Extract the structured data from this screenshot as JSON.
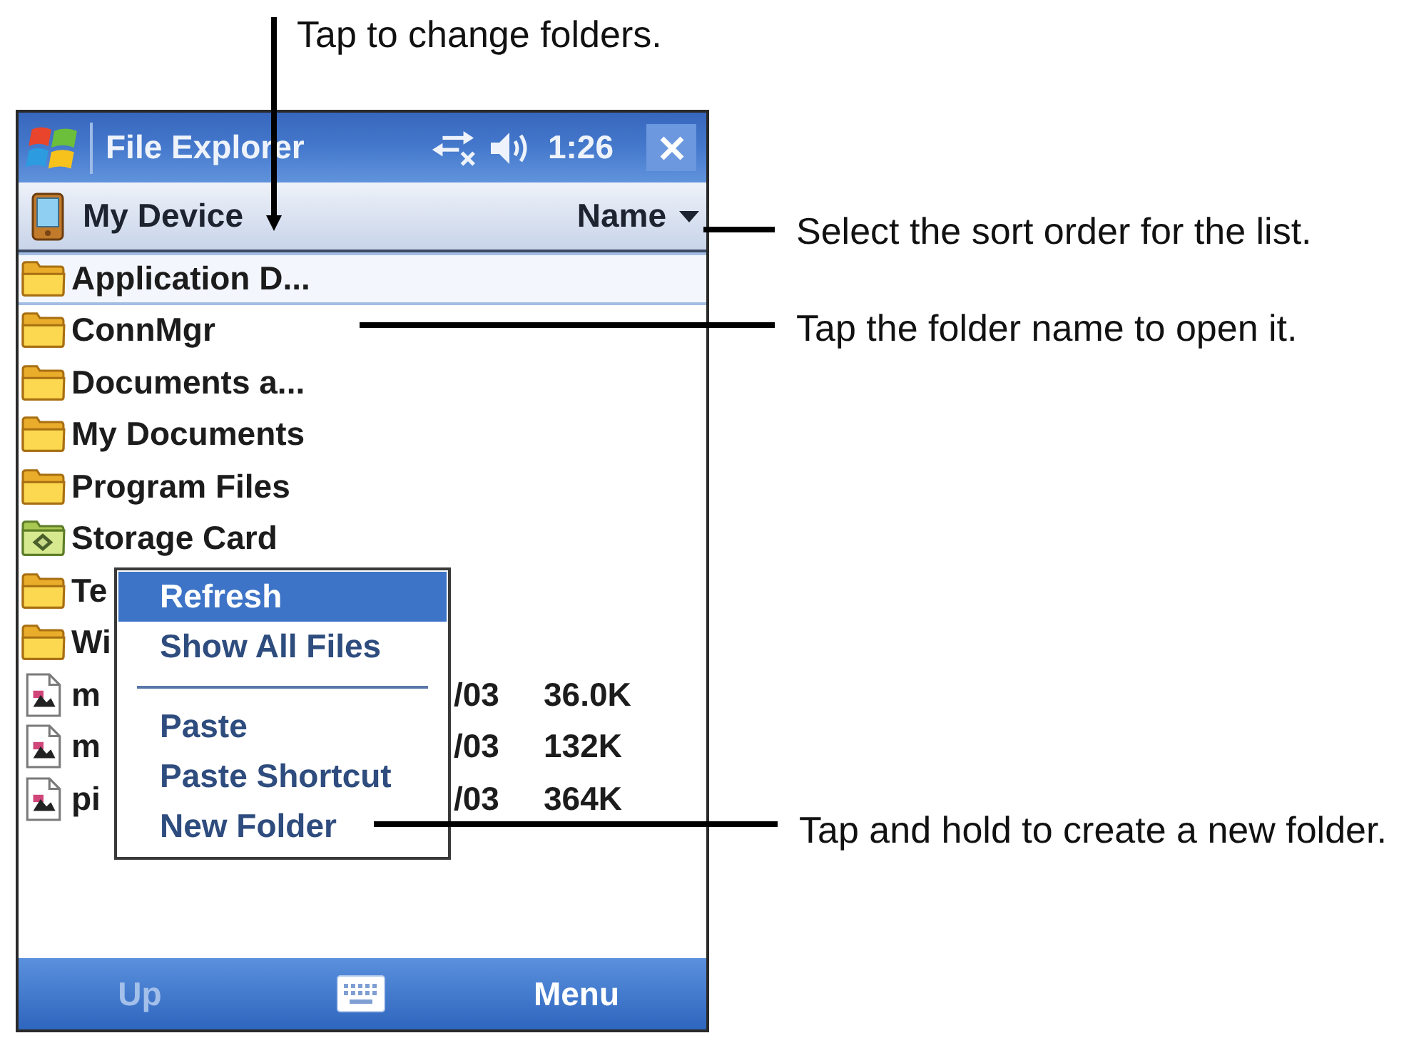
{
  "annotations": [
    {
      "text": "Tap to change folders."
    },
    {
      "text": "Select the sort order for the list."
    },
    {
      "text": "Tap the folder name to open it."
    },
    {
      "text": "Tap and hold to create a new folder."
    }
  ],
  "window": {
    "title": "File Explorer",
    "clock": "1:26"
  },
  "location_bar": {
    "folder": "My Device",
    "sort_by": "Name"
  },
  "files": [
    {
      "kind": "folder",
      "name": "Application D...",
      "selected": true
    },
    {
      "kind": "folder",
      "name": "ConnMgr",
      "selected": false
    },
    {
      "kind": "folder",
      "name": "Documents a...",
      "selected": false
    },
    {
      "kind": "folder",
      "name": "My Documents",
      "selected": false
    },
    {
      "kind": "folder",
      "name": "Program Files",
      "selected": false
    },
    {
      "kind": "storage_card",
      "name": "Storage Card",
      "selected": false
    },
    {
      "kind": "folder",
      "name": "Te",
      "selected": false
    },
    {
      "kind": "folder",
      "name": "Wi",
      "selected": false
    },
    {
      "kind": "file",
      "name": "m",
      "date": "/03",
      "size": "36.0K",
      "selected": false
    },
    {
      "kind": "file",
      "name": "m",
      "date": "/03",
      "size": "132K",
      "selected": false
    },
    {
      "kind": "file",
      "name": "pi",
      "date": "/03",
      "size": "364K",
      "selected": false
    }
  ],
  "context_menu": {
    "groups": [
      [
        {
          "label": "Refresh",
          "selected": true
        },
        {
          "label": "Show All Files",
          "selected": false
        }
      ],
      [
        {
          "label": "Paste",
          "selected": false
        },
        {
          "label": "Paste Shortcut",
          "selected": false
        },
        {
          "label": "New Folder",
          "selected": false
        }
      ]
    ]
  },
  "soft_keys": [
    {
      "label": "Up",
      "disabled": true
    },
    {
      "label": "Menu",
      "disabled": false
    }
  ]
}
